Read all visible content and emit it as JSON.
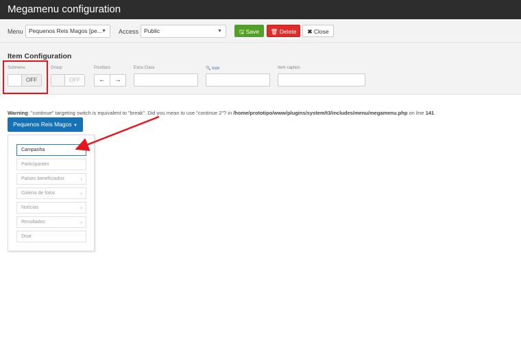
{
  "window": {
    "title": "Megamenu configuration"
  },
  "toolbar": {
    "menu_label": "Menu",
    "menu_value": "Pequenos Reis Magos [pe...",
    "access_label": "Access",
    "access_value": "Public",
    "save_label": "Save",
    "delete_label": "Delete",
    "close_label": "Close",
    "colors": {
      "save": "#54a022",
      "delete": "#e02b2b"
    }
  },
  "item_config": {
    "title": "Item Configuration",
    "submenu_label": "Submenu",
    "submenu_state": "OFF",
    "group_label": "Group",
    "group_state": "OFF",
    "positions_label": "Positions",
    "extra_class_label": "Extra Class",
    "icon_label": "Icon",
    "item_caption_label": "Item caption"
  },
  "warning": {
    "prefix": "Warning",
    "text": ": \"continue\" targeting switch is equivalent to \"break\". Did you mean to use \"continue 2\"? in ",
    "path": "/home/prototipo/www/plugins/system/t3/includes/menu/megamenu.php",
    "on_line": " on line ",
    "line": "141"
  },
  "menu_button": {
    "label": "Pequenos Reis Magos"
  },
  "menu_items": [
    {
      "label": "Campanha",
      "submenu": false,
      "active": true
    },
    {
      "label": "Participantes",
      "submenu": false,
      "active": false
    },
    {
      "label": "Países beneficiados",
      "submenu": true,
      "active": false
    },
    {
      "label": "Galeria de fotos",
      "submenu": true,
      "active": false
    },
    {
      "label": "Notícias",
      "submenu": true,
      "active": false
    },
    {
      "label": "Resultados",
      "submenu": true,
      "active": false
    },
    {
      "label": "Doar",
      "submenu": false,
      "active": false
    }
  ],
  "annotation": {
    "color": "#e8141c"
  }
}
